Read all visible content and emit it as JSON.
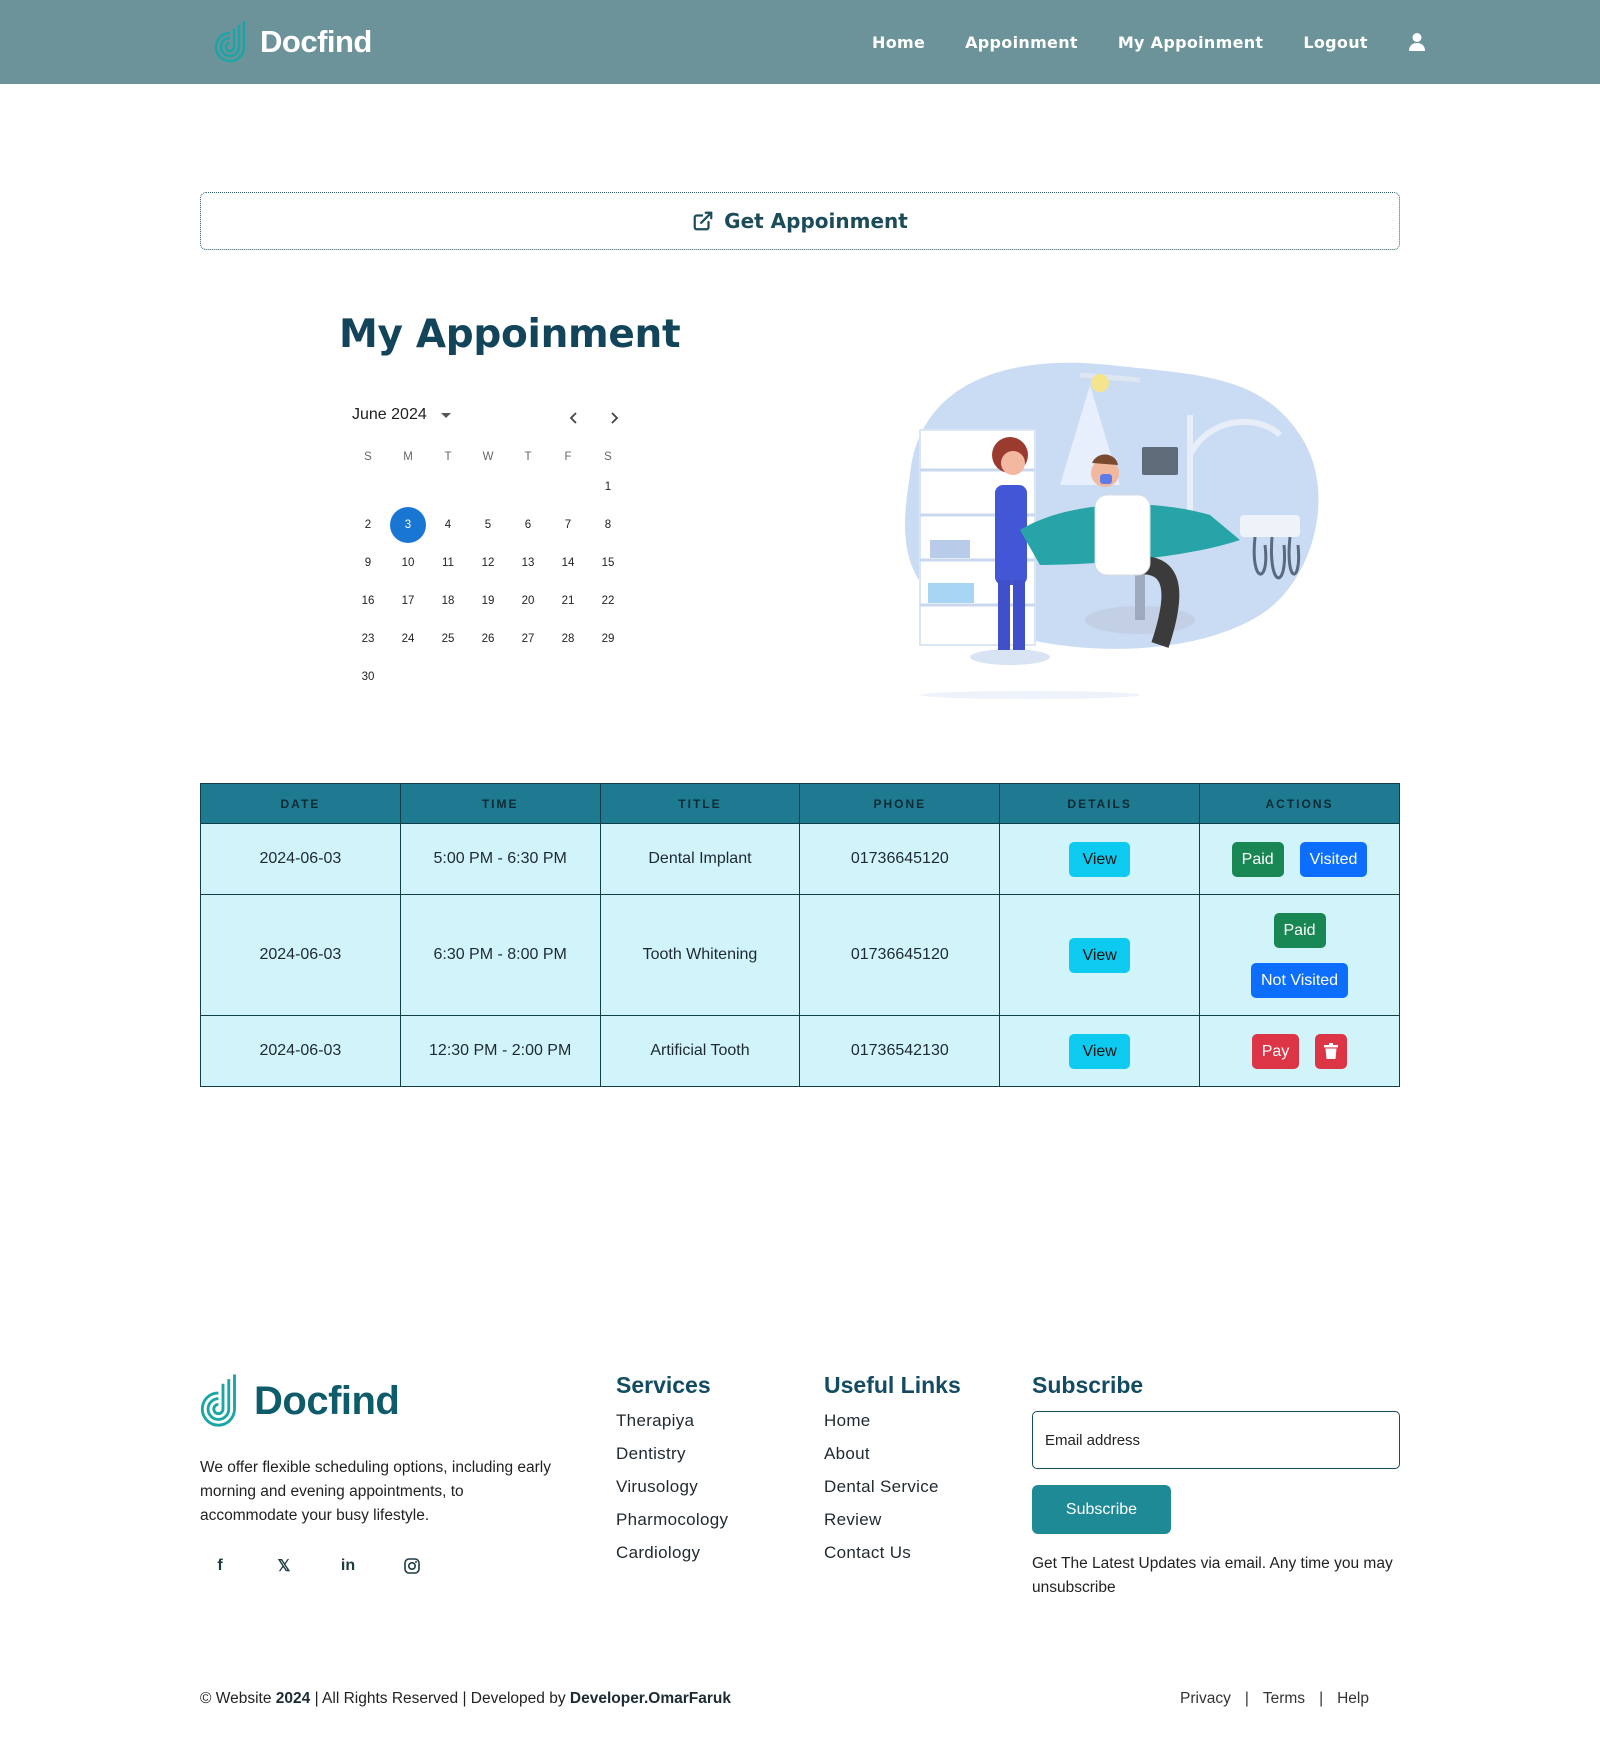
{
  "header": {
    "brand": "Docfind",
    "nav": [
      "Home",
      "Appoinment",
      "My Appoinment",
      "Logout"
    ]
  },
  "get_appointment": {
    "label": "Get Appoinment"
  },
  "page_title": "My Appoinment",
  "calendar": {
    "month_label": "June 2024",
    "weekdays": [
      "S",
      "M",
      "T",
      "W",
      "T",
      "F",
      "S"
    ],
    "weeks": [
      [
        "",
        "",
        "",
        "",
        "",
        "",
        "1"
      ],
      [
        "2",
        "3",
        "4",
        "5",
        "6",
        "7",
        "8"
      ],
      [
        "9",
        "10",
        "11",
        "12",
        "13",
        "14",
        "15"
      ],
      [
        "16",
        "17",
        "18",
        "19",
        "20",
        "21",
        "22"
      ],
      [
        "23",
        "24",
        "25",
        "26",
        "27",
        "28",
        "29"
      ],
      [
        "30",
        "",
        "",
        "",
        "",
        "",
        ""
      ]
    ],
    "selected_day": "3",
    "accent": "#1976d2"
  },
  "table": {
    "headers": [
      "Date",
      "Time",
      "Title",
      "Phone",
      "Details",
      "Actions"
    ],
    "rows": [
      {
        "date": "2024-06-03",
        "time": "5:00 PM - 6:30 PM",
        "title": "Dental Implant",
        "phone": "01736645120",
        "details": "View",
        "actions": [
          "Paid",
          "Visited"
        ]
      },
      {
        "date": "2024-06-03",
        "time": "6:30 PM - 8:00 PM",
        "title": "Tooth Whitening",
        "phone": "01736645120",
        "details": "View",
        "actions": [
          "Paid",
          "Not Visited"
        ]
      },
      {
        "date": "2024-06-03",
        "time": "12:30 PM - 2:00 PM",
        "title": "Artificial Tooth",
        "phone": "01736542130",
        "details": "View",
        "actions": [
          "Pay",
          "trash-icon"
        ]
      }
    ],
    "header_color": "#1e7a91",
    "row_color": "#d1f3fa"
  },
  "footer": {
    "brand": "Docfind",
    "description": "We offer flexible scheduling options, including early morning and evening appointments, to accommodate your busy lifestyle.",
    "socials": [
      "facebook-icon",
      "x-icon",
      "linkedin-icon",
      "instagram-icon"
    ],
    "services": {
      "title": "Services",
      "items": [
        "Therapiya",
        "Dentistry",
        "Virusology",
        "Pharmocology",
        "Cardiology"
      ]
    },
    "links": {
      "title": "Useful Links",
      "items": [
        "Home",
        "About",
        "Dental Service",
        "Review",
        "Contact Us"
      ]
    },
    "subscribe": {
      "title": "Subscribe",
      "placeholder": "Email address",
      "button": "Subscribe",
      "note": "Get The Latest Updates via email. Any time you may unsubscribe"
    },
    "copyright": {
      "prefix": "© Website",
      "year": "2024",
      "middle": "| All Rights Reserved | Developed by",
      "developer": "Developer.OmarFaruk"
    },
    "legal": [
      "Privacy",
      "Terms",
      "Help"
    ]
  },
  "colors": {
    "header_bg": "#6b9399",
    "brand_teal": "#0e5c6b",
    "paid": "#198754",
    "visited": "#0d6efd",
    "danger": "#dc3545",
    "view": "#0dcaf0"
  }
}
